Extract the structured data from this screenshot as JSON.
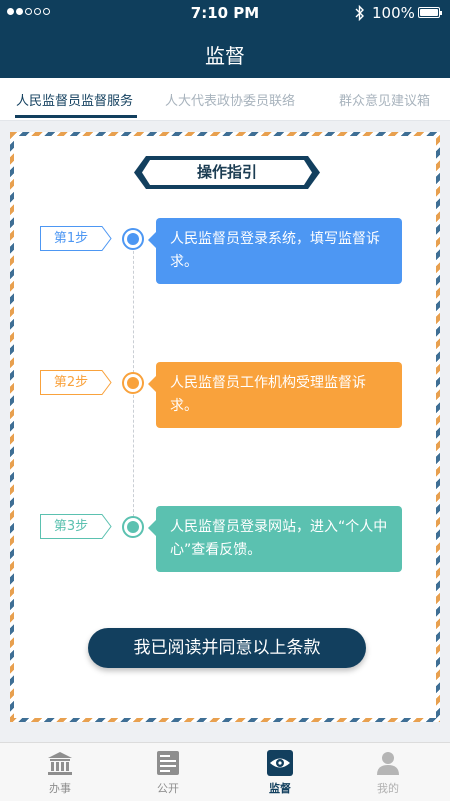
{
  "status_bar": {
    "time": "7:10 PM",
    "battery": "100%"
  },
  "header": {
    "title": "监督"
  },
  "tabs": [
    {
      "label": "人民监督员监督服务",
      "active": true
    },
    {
      "label": "人大代表政协委员联络",
      "active": false
    },
    {
      "label": "群众意见建议箱",
      "active": false
    }
  ],
  "guide": {
    "title": "操作指引",
    "steps": [
      {
        "tag": "第1步",
        "text": "人民监督员登录系统，填写监督诉求。",
        "color": "#4d97f3"
      },
      {
        "tag": "第2步",
        "text": "人民监督员工作机构受理监督诉求。",
        "color": "#f9a23c"
      },
      {
        "tag": "第3步",
        "text": "人民监督员登录网站，进入“个人中心”查看反馈。",
        "color": "#5bc1b0"
      }
    ],
    "agree_button": "我已阅读并同意以上条款"
  },
  "bottom_nav": [
    {
      "label": "办事",
      "icon": "bank-icon",
      "active": false
    },
    {
      "label": "公开",
      "icon": "document-icon",
      "active": false
    },
    {
      "label": "监督",
      "icon": "eye-icon",
      "active": true
    },
    {
      "label": "我的",
      "icon": "user-icon",
      "active": false
    }
  ],
  "colors": {
    "primary": "#0f3e5c",
    "step1": "#4d97f3",
    "step2": "#f9a23c",
    "step3": "#5bc1b0"
  }
}
